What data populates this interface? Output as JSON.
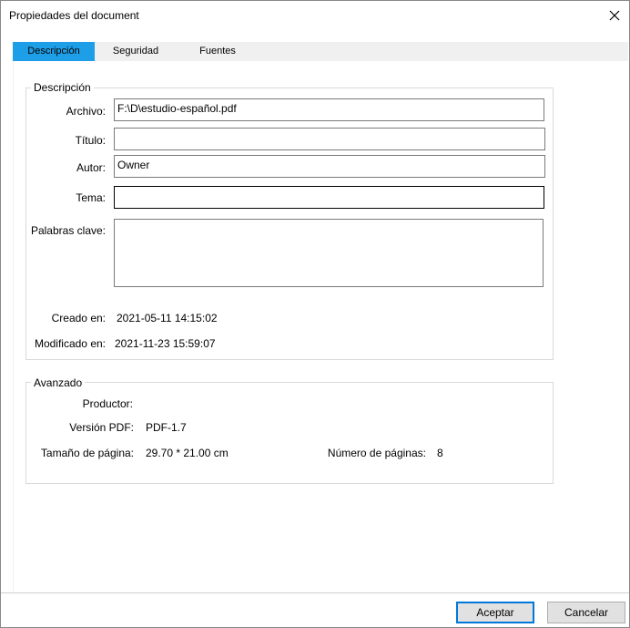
{
  "window": {
    "title": "Propiedades del document"
  },
  "tabs": [
    {
      "label": "Descripción",
      "active": true
    },
    {
      "label": "Seguridad",
      "active": false
    },
    {
      "label": "Fuentes",
      "active": false
    }
  ],
  "description": {
    "group_label": "Descripción",
    "archivo_label": "Archivo:",
    "archivo_value": "F:\\D\\estudio-español.pdf",
    "titulo_label": "Título:",
    "titulo_value": "",
    "autor_label": "Autor:",
    "autor_value": "Owner",
    "tema_label": "Tema:",
    "tema_value": "",
    "palabras_label": "Palabras clave:",
    "palabras_value": "",
    "creado_label": "Creado en:",
    "creado_value": "2021-05-11 14:15:02",
    "modificado_label": "Modificado en:",
    "modificado_value": "2021-11-23 15:59:07"
  },
  "advanced": {
    "group_label": "Avanzado",
    "productor_label": "Productor:",
    "productor_value": "",
    "version_label": "Versión PDF:",
    "version_value": "PDF-1.7",
    "tamano_label": "Tamaño de página:",
    "tamano_value": "29.70 * 21.00 cm",
    "paginas_label": "Número de páginas:",
    "paginas_value": "8"
  },
  "buttons": {
    "ok": "Aceptar",
    "cancel": "Cancelar"
  },
  "colors": {
    "active_tab": "#1e9ee6",
    "default_button_border": "#0078d7"
  }
}
